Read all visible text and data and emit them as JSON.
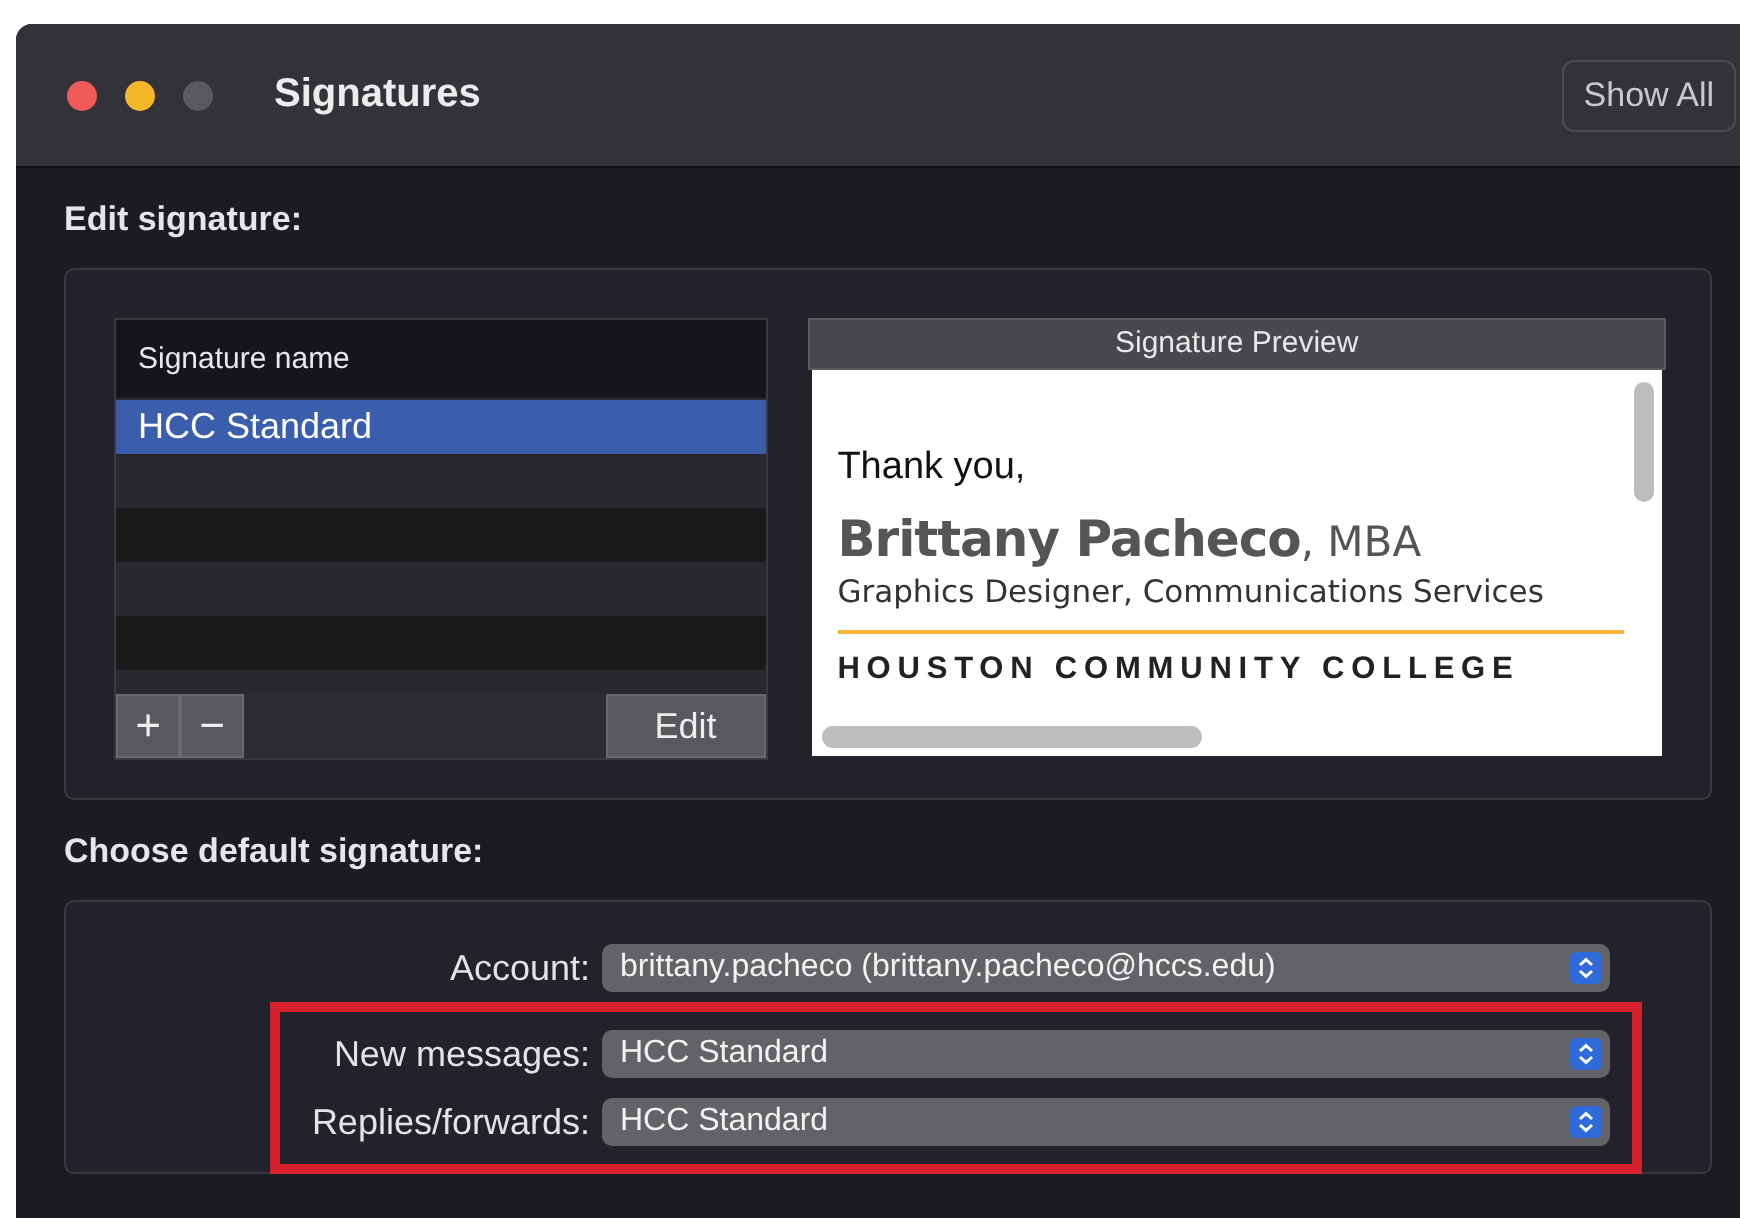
{
  "window": {
    "title": "Signatures"
  },
  "toolbar": {
    "show_all_button": "Show All"
  },
  "edit_section": {
    "label": "Edit signature:",
    "list": {
      "column": "Signature name",
      "rows": [
        {
          "name": "HCC Standard",
          "selected": true
        }
      ]
    },
    "buttons": {
      "add": "+",
      "remove": "−",
      "edit": "Edit"
    },
    "preview": {
      "title": "Signature Preview",
      "greeting": "Thank you,",
      "name": "**Brittany Pacheco**, MBA",
      "job_title": "Graphics Designer, Communications Services",
      "organization": "HOUSTON COMMUNITY COLLEGE"
    }
  },
  "default_section": {
    "label": "Choose default signature:",
    "rows": [
      {
        "label": "Account:",
        "value": "brittany.pacheco (brittany.pacheco@hccs.edu)",
        "highlighted": false
      },
      {
        "label": "New messages:",
        "value": "HCC Standard",
        "highlighted": true
      },
      {
        "label": "Replies/forwards:",
        "value": "HCC Standard",
        "highlighted": true
      }
    ]
  }
}
